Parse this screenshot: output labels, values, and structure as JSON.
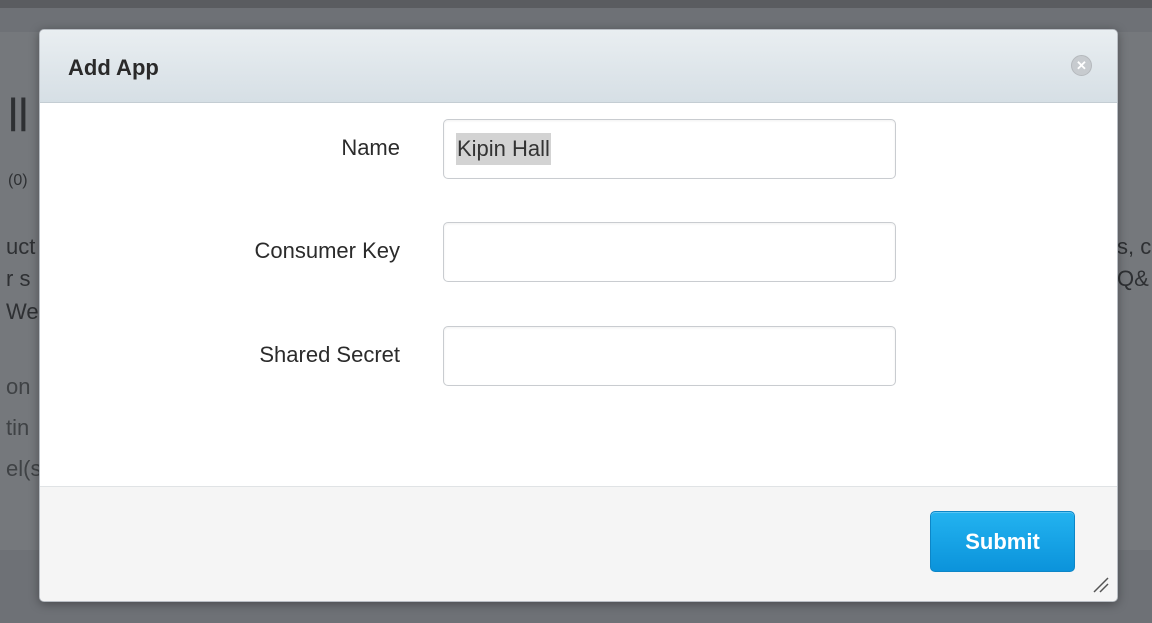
{
  "background": {
    "fragments": [
      "ll",
      "(0)",
      "uct",
      "r s",
      "We",
      "on",
      "tin",
      "el(s",
      "s, c",
      "Q&"
    ]
  },
  "modal": {
    "title": "Add App",
    "close_glyph": "✕",
    "fields": {
      "name": {
        "label": "Name",
        "value": "Kipin Hall",
        "placeholder": ""
      },
      "consumer_key": {
        "label": "Consumer Key",
        "value": "",
        "placeholder": ""
      },
      "shared_secret": {
        "label": "Shared Secret",
        "value": "",
        "placeholder": ""
      }
    },
    "submit_label": "Submit"
  },
  "colors": {
    "header_bg": "#dfe6eb",
    "submit_bg": "#1aa3e6",
    "overlay": "#6e7176"
  },
  "icons": {
    "close": "close-icon",
    "resize": "resize-grip-icon"
  }
}
